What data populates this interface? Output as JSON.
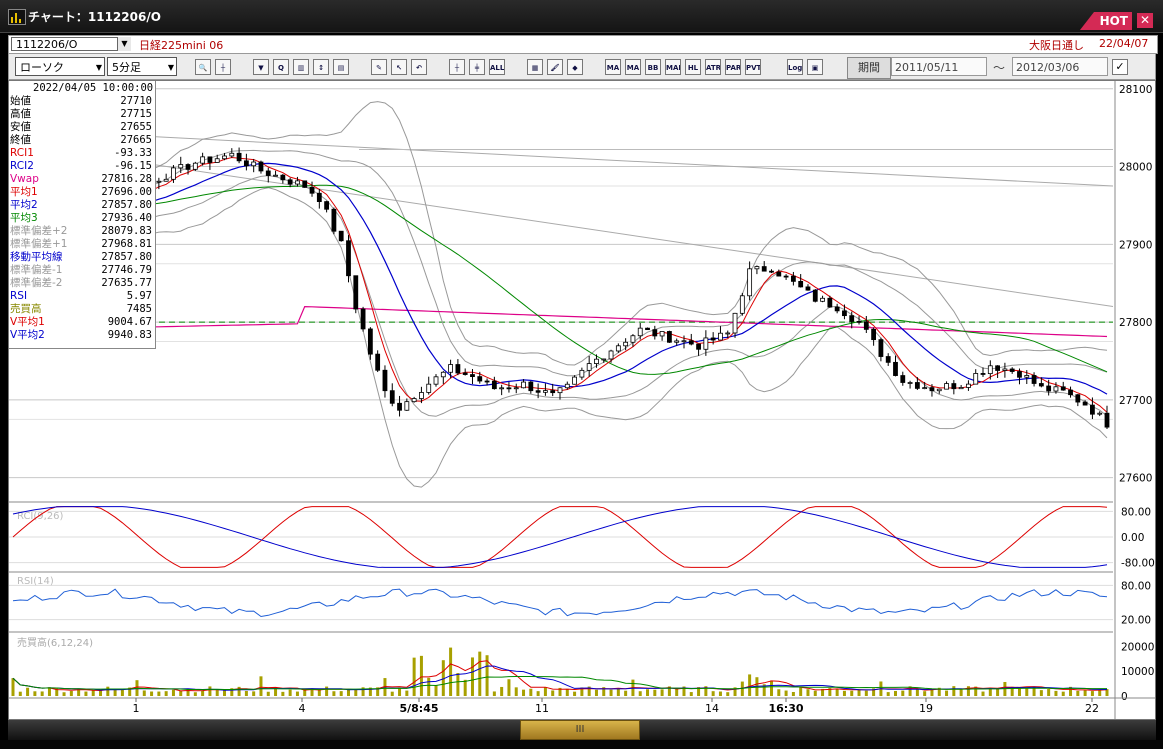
{
  "window": {
    "title": "チャート：1112206/O",
    "hot_label": "HOT",
    "close_glyph": "✕"
  },
  "infobar": {
    "symbol_code": "1112206/O",
    "symbol_name": "日経225mini 06",
    "market": "大阪日通し",
    "date": "22/04/07"
  },
  "toolbar": {
    "chart_type": "ローソク",
    "interval": "5分足",
    "buttons": [
      {
        "name": "zoom",
        "label": "🔍"
      },
      {
        "name": "crosshair",
        "label": "┼"
      },
      {
        "name": "down-arrow",
        "label": "▼"
      },
      {
        "name": "magnify",
        "label": "Q"
      },
      {
        "name": "bars",
        "label": "▥"
      },
      {
        "name": "scale",
        "label": "↕"
      },
      {
        "name": "page",
        "label": "▤"
      },
      {
        "name": "pen",
        "label": "✎"
      },
      {
        "name": "cursor",
        "label": "↖"
      },
      {
        "name": "undo",
        "label": "↶"
      },
      {
        "name": "candle1",
        "label": "┼"
      },
      {
        "name": "candle2",
        "label": "╪"
      },
      {
        "name": "all",
        "label": "ALL"
      },
      {
        "name": "grid",
        "label": "▦"
      },
      {
        "name": "brush",
        "label": "🖌"
      },
      {
        "name": "color",
        "label": "◆"
      },
      {
        "name": "ma",
        "label": "MA"
      },
      {
        "name": "ma2",
        "label": "MA"
      },
      {
        "name": "bb",
        "label": "BB"
      },
      {
        "name": "mae",
        "label": "MAE"
      },
      {
        "name": "hl",
        "label": "HL"
      },
      {
        "name": "atr",
        "label": "ATR"
      },
      {
        "name": "para",
        "label": "PARA"
      },
      {
        "name": "pvt",
        "label": "PVT"
      },
      {
        "name": "log",
        "label": "Log"
      },
      {
        "name": "export",
        "label": "▣"
      }
    ],
    "period_label": "期間",
    "date_from": "2011/05/11",
    "date_to": "2012/03/06",
    "tilde": "～"
  },
  "legend": {
    "datetime": "2022/04/05  10:00:00",
    "rows": [
      {
        "k": "始値",
        "v": "27710",
        "c": "#000000"
      },
      {
        "k": "高値",
        "v": "27715",
        "c": "#000000"
      },
      {
        "k": "安値",
        "v": "27655",
        "c": "#000000"
      },
      {
        "k": "終値",
        "v": "27665",
        "c": "#000000"
      },
      {
        "k": "RCI1",
        "v": "-93.33",
        "c": "#dd0000"
      },
      {
        "k": "RCI2",
        "v": "-96.15",
        "c": "#0000cc"
      },
      {
        "k": "Vwap",
        "v": "27816.28",
        "c": "#dd0088"
      },
      {
        "k": "平均1",
        "v": "27696.00",
        "c": "#dd0000"
      },
      {
        "k": "平均2",
        "v": "27857.80",
        "c": "#0000cc"
      },
      {
        "k": "平均3",
        "v": "27936.40",
        "c": "#008800"
      },
      {
        "k": "標準偏差+2",
        "v": "28079.83",
        "c": "#999999"
      },
      {
        "k": "標準偏差+1",
        "v": "27968.81",
        "c": "#999999"
      },
      {
        "k": "移動平均線",
        "v": "27857.80",
        "c": "#0000cc"
      },
      {
        "k": "標準偏差-1",
        "v": "27746.79",
        "c": "#999999"
      },
      {
        "k": "標準偏差-2",
        "v": "27635.77",
        "c": "#999999"
      },
      {
        "k": "RSI",
        "v": "5.97",
        "c": "#0000cc"
      },
      {
        "k": "売買高",
        "v": "7485",
        "c": "#888800"
      },
      {
        "k": "V平均1",
        "v": "9004.67",
        "c": "#dd0000"
      },
      {
        "k": "V平均2",
        "v": "9940.83",
        "c": "#0000cc"
      }
    ]
  },
  "price_axis": {
    "labels": [
      "28100",
      "28000",
      "27900",
      "27800",
      "27700",
      "27600"
    ]
  },
  "rci_panel": {
    "label": "RCI(9,26)",
    "axis_labels": [
      "80.00",
      "0.00",
      "-80.00"
    ]
  },
  "rsi_panel": {
    "label": "RSI(14)",
    "axis_labels": [
      "80.00",
      "20.00"
    ]
  },
  "volume_panel": {
    "label": "売買高(6,12,24)",
    "axis_labels": [
      "20000",
      "10000",
      "0"
    ]
  },
  "time_axis": {
    "labels": [
      "1",
      "4",
      "5/8:45",
      "11",
      "14",
      "16:30",
      "19",
      "22"
    ],
    "bold": [
      false,
      false,
      true,
      false,
      false,
      true,
      false,
      false
    ]
  },
  "scrollbar": {
    "thumb_label": "III"
  },
  "colors": {
    "up": "#000000",
    "down": "#000000",
    "vwap": "#dd0088",
    "ma1": "#dd0000",
    "ma2": "#0000cc",
    "ma3": "#008800",
    "band": "#999999",
    "volume": "#a8a000",
    "baseline": "#008800"
  },
  "chart_data": [
    {
      "type": "candlestick",
      "title": "",
      "ylim": [
        27570,
        28110
      ],
      "y_ticks": [
        28100,
        28000,
        27900,
        27800,
        27700,
        27600
      ],
      "x_tick_labels": [
        "1",
        "4",
        "5/8:45",
        "11",
        "14",
        "16:30",
        "19",
        "22"
      ],
      "reference_line": 27800,
      "close_path": [
        [
          0,
          27950
        ],
        [
          5,
          27940
        ],
        [
          10,
          27945
        ],
        [
          15,
          27960
        ],
        [
          20,
          27985
        ],
        [
          25,
          28005
        ],
        [
          30,
          28015
        ],
        [
          34,
          27995
        ],
        [
          37,
          27985
        ],
        [
          40,
          27975
        ],
        [
          42,
          27960
        ],
        [
          45,
          27900
        ],
        [
          47,
          27820
        ],
        [
          49,
          27760
        ],
        [
          51,
          27710
        ],
        [
          53,
          27690
        ],
        [
          56,
          27715
        ],
        [
          60,
          27740
        ],
        [
          63,
          27730
        ],
        [
          66,
          27715
        ],
        [
          70,
          27720
        ],
        [
          74,
          27705
        ],
        [
          76,
          27715
        ],
        [
          79,
          27745
        ],
        [
          82,
          27765
        ],
        [
          86,
          27790
        ],
        [
          90,
          27780
        ],
        [
          94,
          27770
        ],
        [
          98,
          27785
        ],
        [
          101,
          27865
        ],
        [
          104,
          27870
        ],
        [
          107,
          27850
        ],
        [
          110,
          27830
        ],
        [
          113,
          27820
        ],
        [
          116,
          27800
        ],
        [
          119,
          27760
        ],
        [
          122,
          27725
        ],
        [
          126,
          27715
        ],
        [
          130,
          27720
        ],
        [
          134,
          27745
        ],
        [
          138,
          27735
        ],
        [
          141,
          27715
        ],
        [
          144,
          27710
        ],
        [
          147,
          27695
        ],
        [
          150,
          27670
        ]
      ]
    },
    {
      "type": "line",
      "name": "RCI",
      "ylim": [
        -100,
        100
      ]
    },
    {
      "type": "line",
      "name": "RSI",
      "ylim": [
        0,
        100
      ]
    },
    {
      "type": "bar",
      "name": "売買高",
      "ylim": [
        0,
        25000
      ]
    }
  ]
}
